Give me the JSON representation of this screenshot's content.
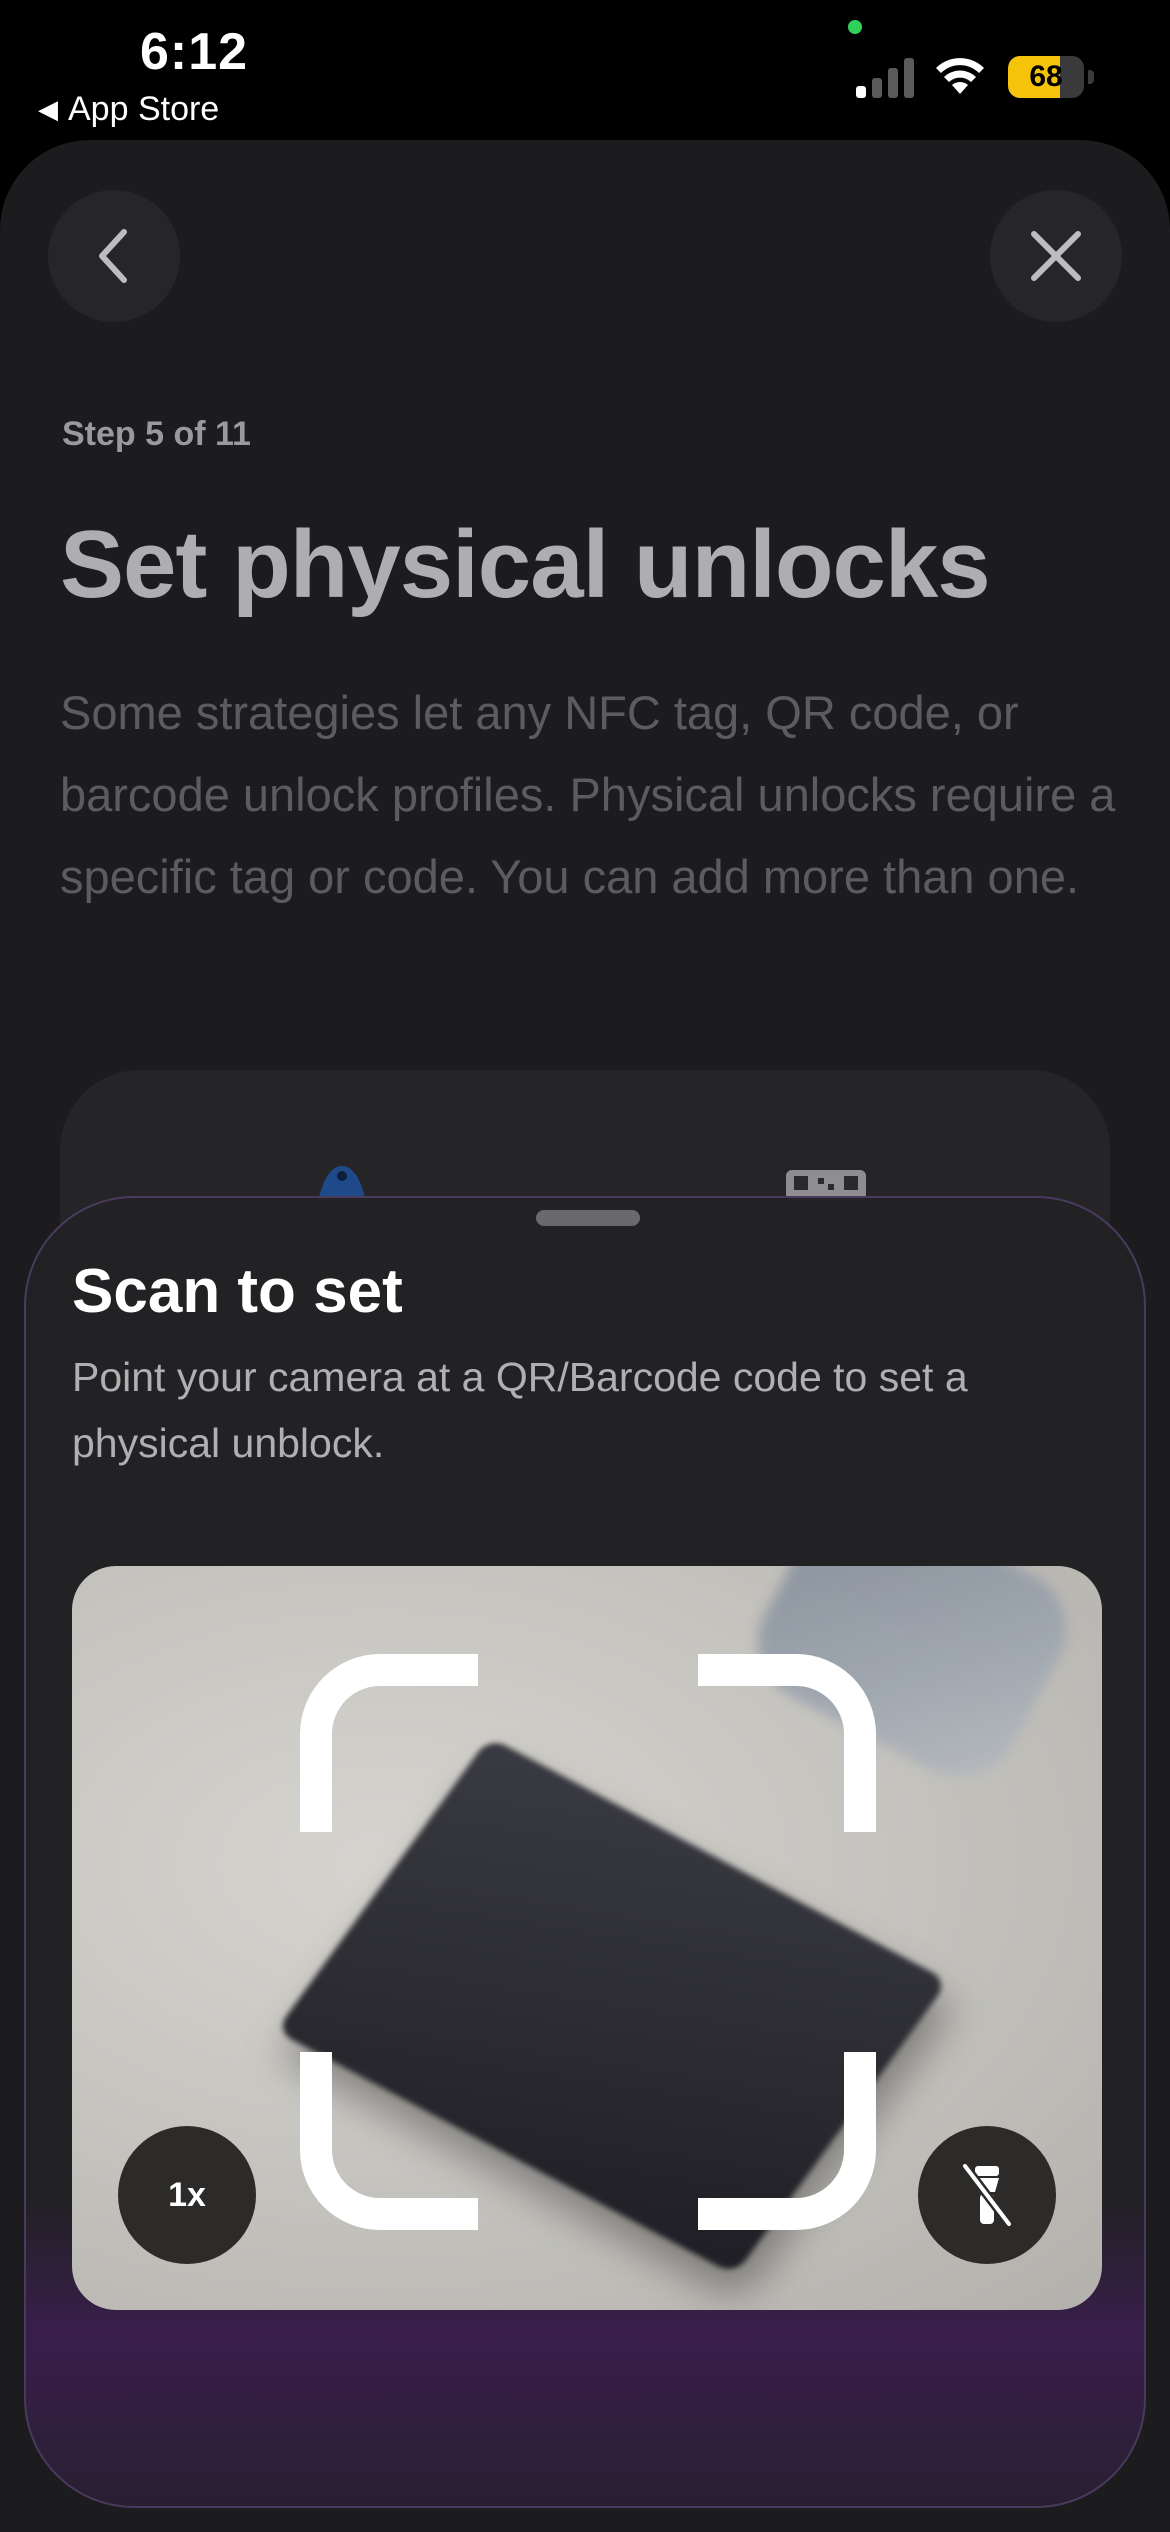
{
  "status_bar": {
    "time": "6:12",
    "back_app": "App Store",
    "battery_level": "68",
    "battery_percent": 68,
    "battery_color": "#f5c30a",
    "privacy_dot_color": "#30d158"
  },
  "nav": {
    "back_icon": "chevron-left-icon",
    "close_icon": "close-icon"
  },
  "header": {
    "step": "Step 5 of 11",
    "title": "Set physical unlocks",
    "description": "Some strategies let any NFC tag, QR code, or barcode unlock profiles. Physical unlocks require a specific tag or code. You can add more than one."
  },
  "options": {
    "icons": [
      "nfc-tag-icon",
      "qr-code-icon"
    ]
  },
  "scan_sheet": {
    "title": "Scan to set",
    "description": "Point your camera at a QR/Barcode code to set a physical unblock.",
    "zoom_label": "1x",
    "torch_icon": "flashlight-off-icon",
    "accent_color": "#4a3a5e"
  }
}
